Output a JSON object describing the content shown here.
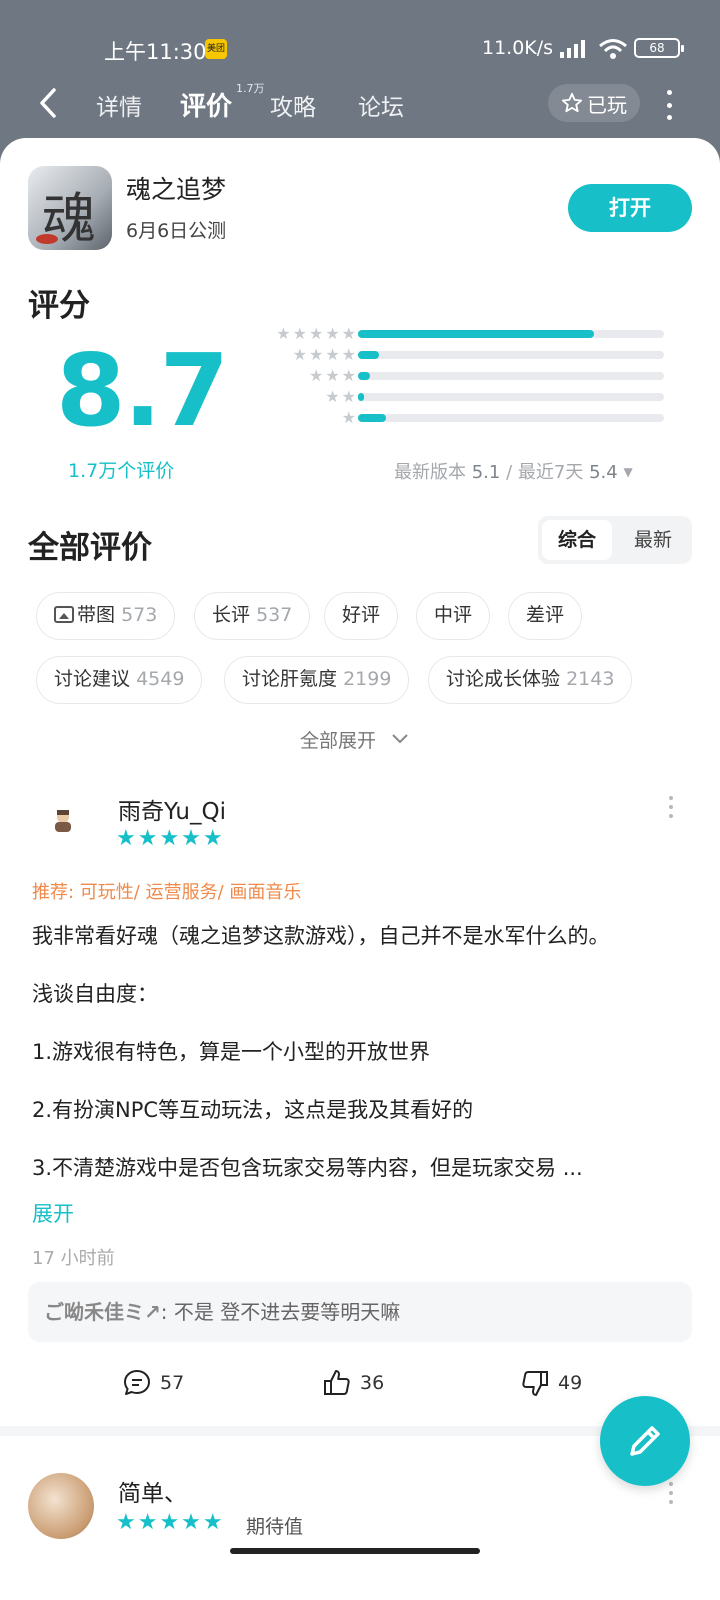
{
  "status": {
    "time": "上午11:30",
    "badge": "美团",
    "speed": "11.0K/s",
    "battery": "68"
  },
  "nav": {
    "tabs": [
      "详情",
      "评价",
      "攻略",
      "论坛"
    ],
    "active_tab": "评价",
    "review_tab_count": "1.7万",
    "played_label": "已玩"
  },
  "app": {
    "name": "魂之追梦",
    "icon_glyph": "魂",
    "subtitle": "6月6日公测",
    "open_label": "打开"
  },
  "rating": {
    "title": "评分",
    "score": "8.7",
    "count": "1.7万个评价",
    "distribution": [
      {
        "stars": 5,
        "fraction": 0.77
      },
      {
        "stars": 4,
        "fraction": 0.07
      },
      {
        "stars": 3,
        "fraction": 0.04
      },
      {
        "stars": 2,
        "fraction": 0.02
      },
      {
        "stars": 1,
        "fraction": 0.09
      }
    ],
    "latest_version_label": "最新版本",
    "latest_version_score": "5.1",
    "recent_label": "最近7天",
    "recent_score": "5.4"
  },
  "reviews_section": {
    "title": "全部评价",
    "sort_options": [
      "综合",
      "最新"
    ],
    "sort_selected": "综合",
    "filters_row1": [
      {
        "label": "带图",
        "count": "573",
        "icon": "image-icon"
      },
      {
        "label": "长评",
        "count": "537"
      },
      {
        "label": "好评",
        "count": ""
      },
      {
        "label": "中评",
        "count": ""
      },
      {
        "label": "差评",
        "count": ""
      }
    ],
    "filters_row2": [
      {
        "label": "讨论建议",
        "count": "4549"
      },
      {
        "label": "讨论肝氪度",
        "count": "2199"
      },
      {
        "label": "讨论成长体验",
        "count": "2143"
      }
    ],
    "expand_all_label": "全部展开"
  },
  "review1": {
    "user": "雨奇Yu_Qi",
    "stars": "★★★★★",
    "recommend": "推荐: 可玩性/ 运营服务/ 画面音乐",
    "lines": [
      "我非常看好魂（魂之追梦这款游戏），自己并不是水军什么的。",
      "浅谈自由度：",
      "1.游戏很有特色，算是一个小型的开放世界",
      "2.有扮演NPC等互动玩法，这点是我及其看好的",
      "3.不清楚游戏中是否包含玩家交易等内容，但是玩家交易 ..."
    ],
    "expand_label": "展开",
    "time": "17 小时前",
    "reply_name": "ご呦禾佳ミ↗",
    "reply_text": ": 不是 登不进去要等明天嘛",
    "comments": "57",
    "likes": "36",
    "dislikes": "49"
  },
  "review2": {
    "user": "简单、",
    "stars": "★★★★★",
    "tag": "期待值"
  },
  "colors": {
    "accent": "#17c0c8",
    "header_bg": "#6f7782",
    "recommend": "#ef8a4a"
  }
}
